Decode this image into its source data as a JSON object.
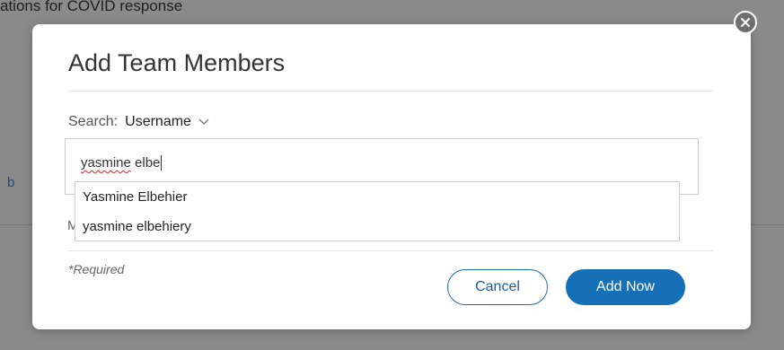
{
  "background": {
    "text": "ations for COVID response",
    "letter": "b"
  },
  "modal": {
    "title": "Add Team Members",
    "close_icon": "close-circle-icon",
    "search": {
      "label": "Search:",
      "type": "Username",
      "chevron_icon": "chevron-down-icon",
      "value": "yasmine elbe",
      "value_misspelled_part": "yasmine",
      "value_rest": " elbe"
    },
    "suggestions": [
      "Yasmine Elbehier",
      "yasmine elbehiery"
    ],
    "partial_label": "M",
    "required_note": "*Required",
    "buttons": {
      "cancel": "Cancel",
      "add": "Add Now"
    }
  },
  "colors": {
    "primary": "#1570b8",
    "overlay": "#8a8a8a",
    "spell_error": "#d22b2b"
  }
}
